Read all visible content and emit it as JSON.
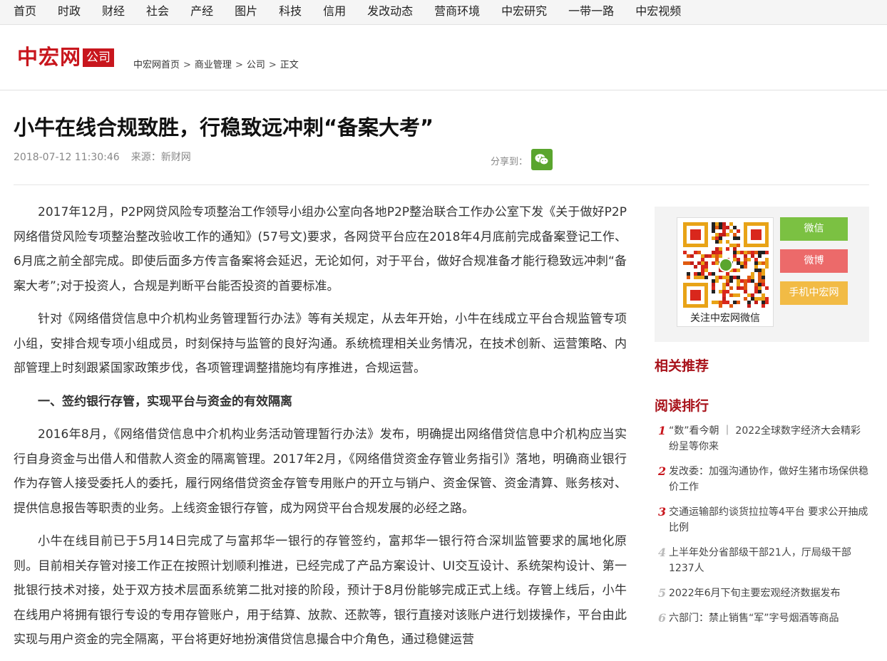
{
  "nav": [
    "首页",
    "时政",
    "财经",
    "社会",
    "产经",
    "图片",
    "科技",
    "信用",
    "发改动态",
    "营商环境",
    "中宏研究",
    "一带一路",
    "中宏视频"
  ],
  "logo": "中宏网",
  "channel": "公司",
  "breadcrumb": [
    "中宏网首页",
    "商业管理",
    "公司",
    "正文"
  ],
  "breadcrumb_sep": ">",
  "article": {
    "title": "小牛在线合规致胜，行稳致远冲刺“备案大考”",
    "datetime": "2018-07-12 11:30:46",
    "source": "来源：新财网",
    "share_label": "分享到：",
    "paragraphs": [
      "2017年12月，P2P网贷风险专项整治工作领导小组办公室向各地P2P整治联合工作办公室下发《关于做好P2P网络借贷风险专项整治整改验收工作的通知》(57号文)要求，各网贷平台应在2018年4月底前完成备案登记工作、6月底之前全部完成。即使后面多方传言备案将会延迟，无论如何，对于平台，做好合规准备才能行稳致远冲刺“备案大考”;对于投资人，合规是判断平台能否投资的首要标准。",
      "针对《网络借贷信息中介机构业务管理暂行办法》等有关规定，从去年开始，小牛在线成立平台合规监管专项小组，安排合规专项小组成员，时刻保持与监管的良好沟通。系统梳理相关业务情况，在技术创新、运营策略、内部管理上时刻跟紧国家政策步伐，各项管理调整措施均有序推进，合规运营。",
      "一、签约银行存管，实现平台与资金的有效隔离",
      "2016年8月，《网络借贷信息中介机构业务活动管理暂行办法》发布，明确提出网络借贷信息中介机构应当实行自身资金与出借人和借款人资金的隔离管理。2017年2月，《网络借贷资金存管业务指引》落地，明确商业银行作为存管人接受委托人的委托，履行网络借贷资金存管专用账户的开立与销户、资金保管、资金清算、账务核对、提供信息报告等职责的业务。上线资金银行存管，成为网贷平台合规发展的必经之路。",
      "小牛在线目前已于5月14日完成了与富邦华一银行的存管签约，富邦华一银行符合深圳监管要求的属地化原则。目前相关存管对接工作正在按照计划顺利推进，已经完成了产品方案设计、UI交互设计、系统架构设计、第一批银行技术对接，处于双方技术层面系统第二批对接的阶段，预计于8月份能够完成正式上线。存管上线后，小牛在线用户将拥有银行专设的专用存管账户，用于结算、放款、还款等，银行直接对该账户进行划拨操作，平台由此实现与用户资金的完全隔离，平台将更好地扮演借贷信息撮合中介角色，通过稳健运营"
    ]
  },
  "sidebar": {
    "qr_caption": "关注中宏网微信",
    "btn_weixin": "微信",
    "btn_weibo": "微博",
    "btn_mobile": "手机中宏网",
    "related_title": "相关推荐",
    "ranking_title": "阅读排行",
    "ranking": [
      {
        "num": "1",
        "text": "“数”看今朝 ｜ 2022全球数字经济大会精彩纷呈等你来"
      },
      {
        "num": "2",
        "text": "发改委：加强沟通协作，做好生猪市场保供稳价工作"
      },
      {
        "num": "3",
        "text": "交通运输部约谈货拉拉等4平台 要求公开抽成比例"
      },
      {
        "num": "4",
        "text": "上半年处分省部级干部21人，厅局级干部1237人"
      },
      {
        "num": "5",
        "text": "2022年6月下旬主要宏观经济数据发布"
      },
      {
        "num": "6",
        "text": "六部门：禁止销售“军”字号烟酒等商品"
      }
    ]
  },
  "colors": {
    "brand_red": "#c8161d",
    "wechat_green": "#5aa52e",
    "weibo_red": "#ec6a6a",
    "mobile_yellow": "#f2bb45"
  }
}
